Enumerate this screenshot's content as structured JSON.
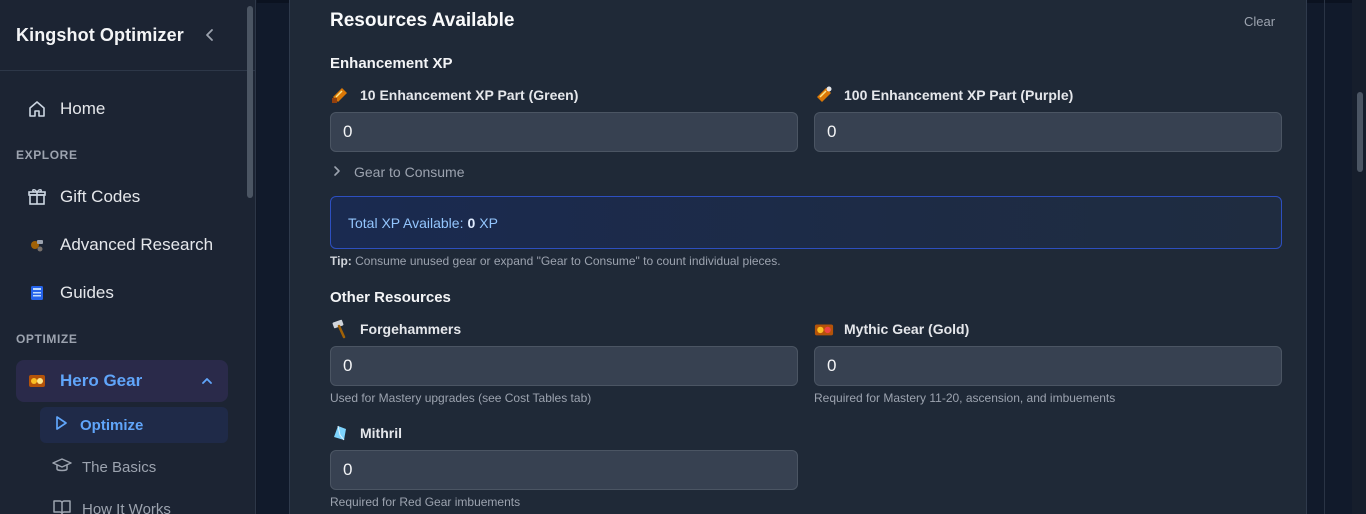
{
  "sidebar": {
    "app_title": "Kingshot Optimizer",
    "nav": {
      "home": "Home",
      "explore_label": "EXPLORE",
      "gift_codes": "Gift Codes",
      "advanced_research": "Advanced Research",
      "guides": "Guides",
      "optimize_label": "OPTIMIZE",
      "hero_gear": "Hero Gear",
      "optimize": "Optimize",
      "the_basics": "The Basics",
      "how_it_works": "How It Works"
    }
  },
  "main": {
    "title": "Resources Available",
    "clear_label": "Clear",
    "enhancement": {
      "heading": "Enhancement XP",
      "green_label": "10 Enhancement XP Part (Green)",
      "green_value": "0",
      "purple_label": "100 Enhancement XP Part (Purple)",
      "purple_value": "0",
      "gear_to_consume": "Gear to Consume",
      "total_prefix": "Total XP Available:",
      "total_value": "0",
      "total_suffix": "XP",
      "tip_bold": "Tip:",
      "tip_text": "Consume unused gear or expand \"Gear to Consume\" to count individual pieces."
    },
    "other": {
      "heading": "Other Resources",
      "forgehammers_label": "Forgehammers",
      "forgehammers_value": "0",
      "forgehammers_help": "Used for Mastery upgrades (see Cost Tables tab)",
      "mythic_label": "Mythic Gear (Gold)",
      "mythic_value": "0",
      "mythic_help": "Required for Mastery 11-20, ascension, and imbuements",
      "mithril_label": "Mithril",
      "mithril_value": "0",
      "mithril_help": "Required for Red Gear imbuements"
    }
  },
  "colors": {
    "accent": "#60a5fa",
    "background": "#111827",
    "card": "#1f2937",
    "input": "#374151"
  },
  "icons": [
    "home-icon",
    "gift-icon",
    "research-icon",
    "guides-icon",
    "hero-gear-icon",
    "play-icon",
    "graduation-cap-icon",
    "book-icon",
    "chevron-left-icon",
    "chevron-up-icon",
    "chevron-right-icon",
    "xp-part-green-icon",
    "xp-part-purple-icon",
    "forgehammer-icon",
    "mythic-gear-icon",
    "mithril-icon"
  ]
}
